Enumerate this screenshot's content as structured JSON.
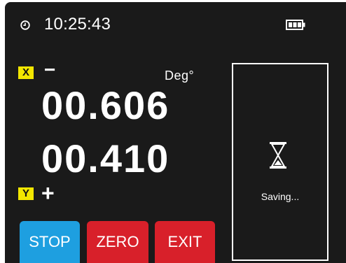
{
  "status": {
    "time": "10:25:43",
    "clock_icon": "clock-icon",
    "battery_icon": "battery-icon",
    "battery_level": 1.0
  },
  "readout": {
    "x_axis": {
      "label": "X",
      "sign": "−",
      "value": "00.606"
    },
    "y_axis": {
      "label": "Y",
      "sign": "+",
      "value": "00.410"
    },
    "unit": "Deg°"
  },
  "buttons": {
    "stop": "STOP",
    "zero": "ZERO",
    "exit": "EXIT"
  },
  "saving": {
    "icon": "hourglass-icon",
    "text": "Saving..."
  },
  "colors": {
    "background": "#1a1a1a",
    "axis_badge": "#f2e600",
    "stop_button": "#1e9fe0",
    "zero_button": "#d8202a",
    "exit_button": "#d8202a"
  }
}
